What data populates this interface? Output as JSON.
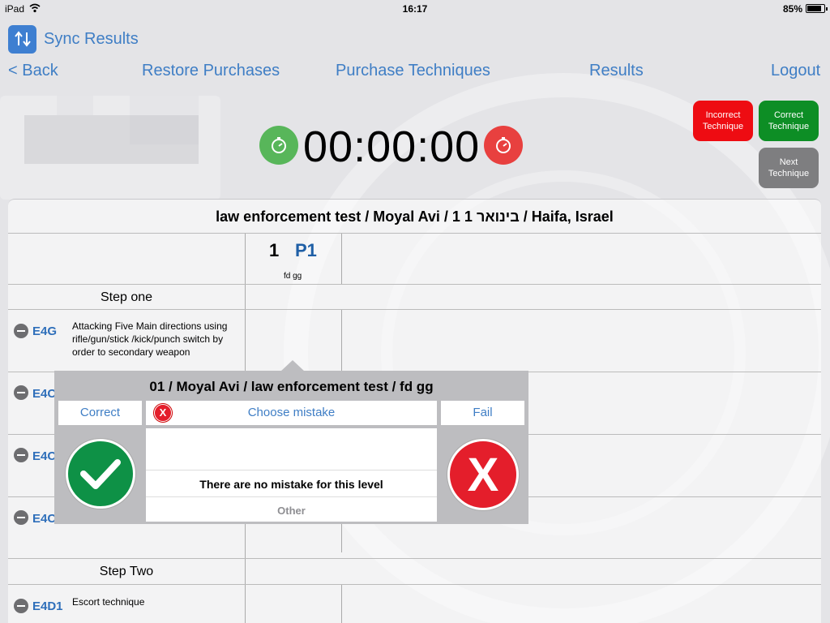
{
  "status": {
    "device": "iPad",
    "time": "16:17",
    "battery": "85%",
    "battery_level": 0.85
  },
  "header": {
    "sync_label": "Sync Results"
  },
  "nav": {
    "back": "< Back",
    "restore": "Restore Purchases",
    "purchase": "Purchase Techniques",
    "results": "Results",
    "logout": "Logout"
  },
  "timer": {
    "value": "00:00:00"
  },
  "actions": {
    "incorrect": "Incorrect\nTechnique",
    "correct": "Correct\nTechnique",
    "next": "Next\nTechnique"
  },
  "table": {
    "title": "law enforcement test / Moyal Avi / 1 1 בינואר / Haifa, Israel",
    "column": {
      "number": "1",
      "code": "P1",
      "sub": "fd gg"
    },
    "steps": [
      "Step one",
      "Step Two"
    ],
    "rows": [
      {
        "code": "E4G",
        "desc": "Attacking Five Main directions using rifle/gun/stick /kick/punch switch by order to secondary weapon"
      },
      {
        "code": "E4C",
        "desc": ""
      },
      {
        "code": "E4C",
        "desc": ""
      },
      {
        "code": "E4C",
        "desc": ""
      },
      {
        "code": "E4D1",
        "desc": "Escort technique"
      }
    ]
  },
  "popup": {
    "title": "01 / Moyal Avi / law enforcement test / fd gg",
    "correct": "Correct",
    "choose_mistake": "Choose mistake",
    "fail": "Fail",
    "no_mistake": "There are no mistake for this level",
    "other": "Other",
    "mistake_x": "X",
    "fail_x": "X"
  }
}
